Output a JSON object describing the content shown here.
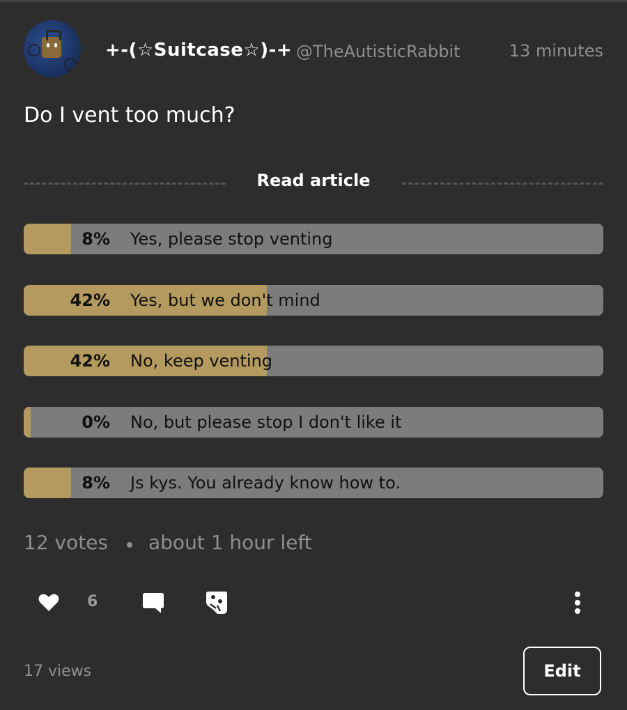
{
  "post": {
    "author_name": "+-(☆Suitcase☆)-+",
    "author_handle": "@TheAutisticRabbit",
    "timestamp": "13 minutes",
    "question": "Do I vent too much?",
    "read_article_label": "Read article"
  },
  "poll": {
    "options": [
      {
        "percent_label": "8%",
        "percent": 8,
        "label": "Yes, please stop venting"
      },
      {
        "percent_label": "42%",
        "percent": 42,
        "label": "Yes, but we don't mind"
      },
      {
        "percent_label": "42%",
        "percent": 42,
        "label": "No, keep venting"
      },
      {
        "percent_label": "0%",
        "percent": 0,
        "label": "No, but please stop I don't like it"
      },
      {
        "percent_label": "8%",
        "percent": 8,
        "label": "Js kys. You already know how to."
      }
    ],
    "votes": "12 votes",
    "time_left": "about 1 hour left",
    "bar_color": "#b49a5f",
    "track_color": "#7c7c7c"
  },
  "actions": {
    "like_count": "6",
    "like_icon": "heart-icon",
    "comment_icon": "comment-bubble-icon",
    "share_icon": "share-icon",
    "more_icon": "more-vertical-icon"
  },
  "footer": {
    "views": "17 views",
    "edit_label": "Edit"
  }
}
